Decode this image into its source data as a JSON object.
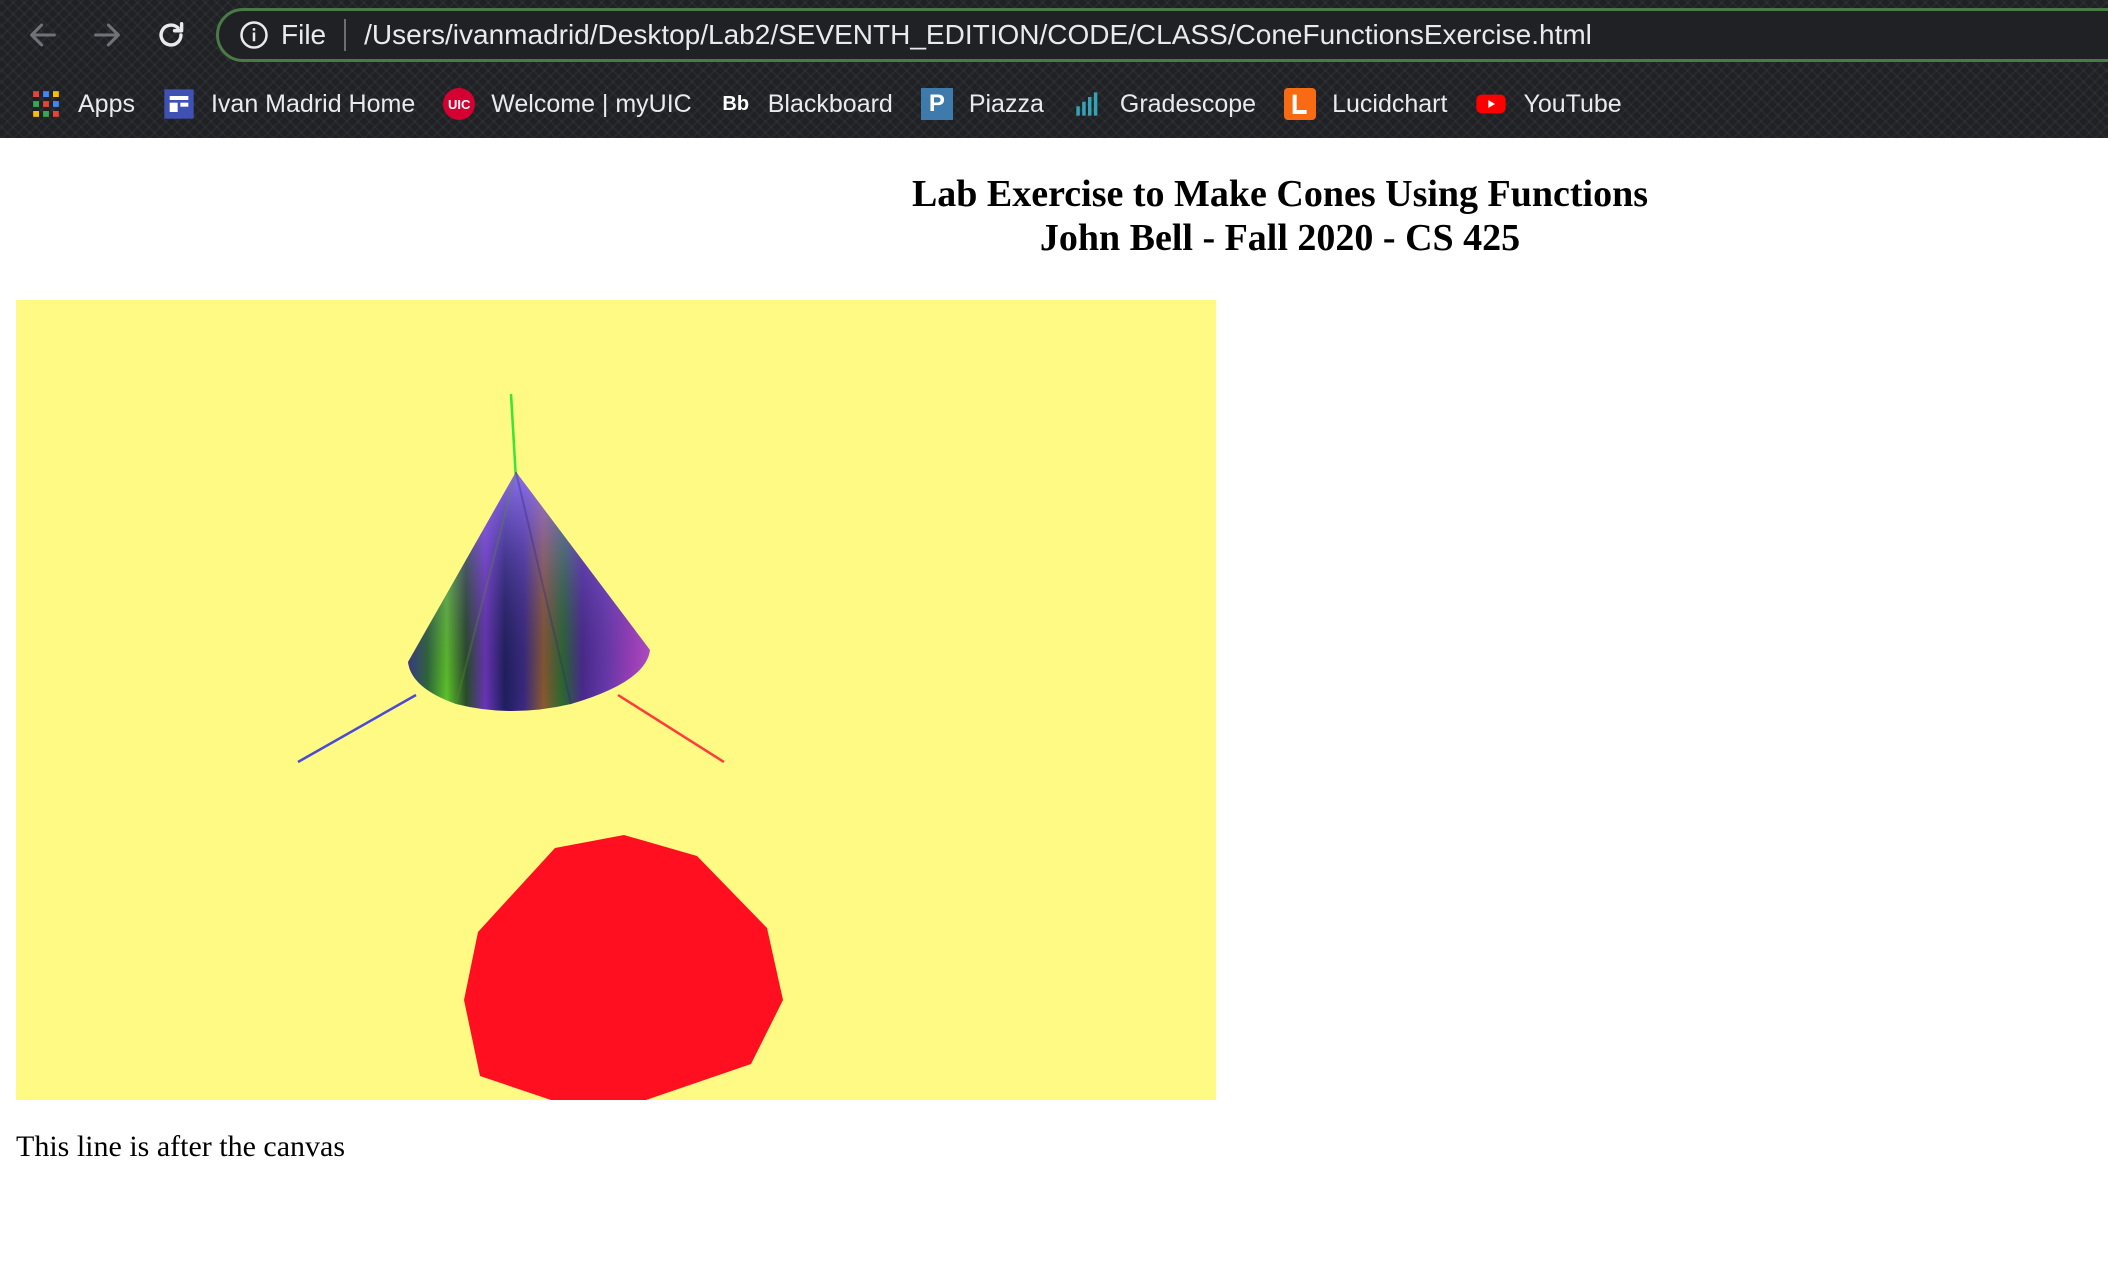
{
  "browser": {
    "address": {
      "scheme_label": "File",
      "url": "/Users/ivanmadrid/Desktop/Lab2/SEVENTH_EDITION/CODE/CLASS/ConeFunctionsExercise.html"
    },
    "bookmarks": [
      {
        "label": "Apps",
        "icon": "apps-grid-icon"
      },
      {
        "label": "Ivan Madrid Home",
        "icon": "site-icon"
      },
      {
        "label": "Welcome | myUIC",
        "icon": "uic-icon"
      },
      {
        "label": "Blackboard",
        "icon": "blackboard-icon"
      },
      {
        "label": "Piazza",
        "icon": "piazza-icon"
      },
      {
        "label": "Gradescope",
        "icon": "gradescope-icon"
      },
      {
        "label": "Lucidchart",
        "icon": "lucidchart-icon"
      },
      {
        "label": "YouTube",
        "icon": "youtube-icon"
      }
    ],
    "uic_badge_text": "UIC",
    "bb_badge_text": "Bb",
    "p_badge_text": "P"
  },
  "page": {
    "title_line1": "Lab Exercise to Make Cones Using Functions",
    "title_line2": "John Bell - Fall 2020 - CS 425",
    "after_canvas_text": "This line is after the canvas"
  },
  "colors": {
    "canvas_background": "#fffa84",
    "disk": "#ff0f1f",
    "axis_x": "#ff3b3b",
    "axis_y": "#37e637",
    "axis_z": "#4a4ad8"
  }
}
